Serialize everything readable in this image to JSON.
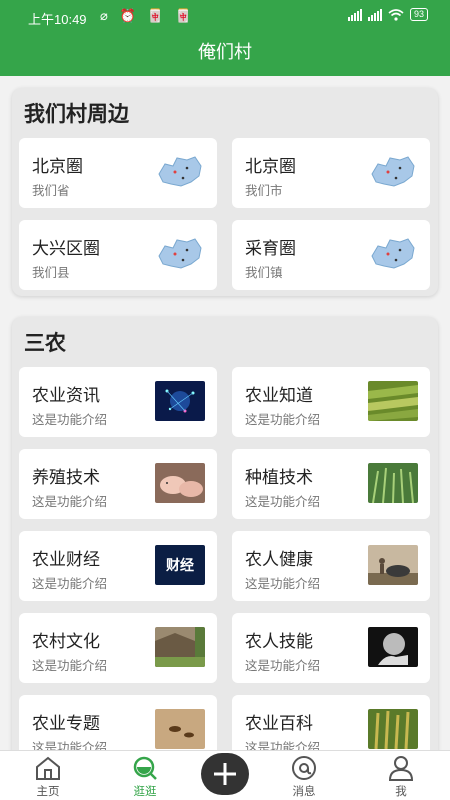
{
  "status": {
    "time": "上午10:49",
    "icons": "⌀ ⏰ 🀄 🀄",
    "battery": "93"
  },
  "header": {
    "title": "俺们村"
  },
  "section1": {
    "title": "我们村周边",
    "items": [
      {
        "name": "北京圈",
        "sub": "我们省"
      },
      {
        "name": "北京圈",
        "sub": "我们市"
      },
      {
        "name": "大兴区圈",
        "sub": "我们县"
      },
      {
        "name": "采育圈",
        "sub": "我们镇"
      }
    ]
  },
  "section2": {
    "title": "三农",
    "items": [
      {
        "name": "农业资讯",
        "sub": "这是功能介绍"
      },
      {
        "name": "农业知道",
        "sub": "这是功能介绍"
      },
      {
        "name": "养殖技术",
        "sub": "这是功能介绍"
      },
      {
        "name": "种植技术",
        "sub": "这是功能介绍"
      },
      {
        "name": "农业财经",
        "sub": "这是功能介绍",
        "thumb_text": "财经"
      },
      {
        "name": "农人健康",
        "sub": "这是功能介绍"
      },
      {
        "name": "农村文化",
        "sub": "这是功能介绍"
      },
      {
        "name": "农人技能",
        "sub": "这是功能介绍"
      },
      {
        "name": "农业专题",
        "sub": "这是功能介绍"
      },
      {
        "name": "农业百科",
        "sub": "这是功能介绍"
      }
    ]
  },
  "nav": [
    {
      "label": "主页",
      "icon": "home-icon"
    },
    {
      "label": "逛逛",
      "icon": "explore-icon",
      "active": true
    },
    {
      "label": "",
      "icon": "add-icon"
    },
    {
      "label": "消息",
      "icon": "message-icon"
    },
    {
      "label": "我",
      "icon": "profile-icon"
    }
  ],
  "colors": {
    "primary": "#35a54a"
  }
}
